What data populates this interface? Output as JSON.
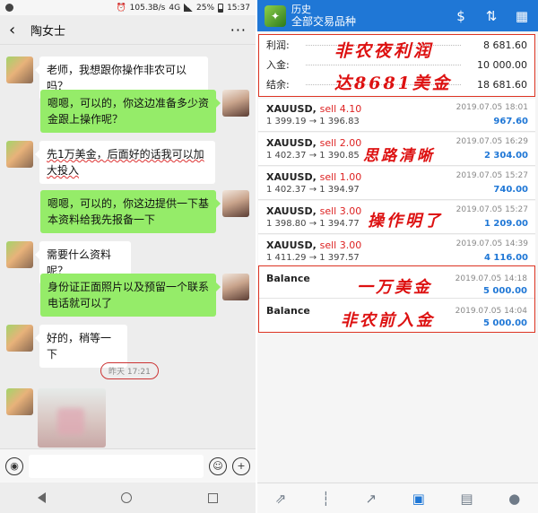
{
  "chat": {
    "status": {
      "speed": "105.3B/s",
      "network": "4G",
      "battery": "25%",
      "time": "15:37"
    },
    "header": {
      "back": "‹",
      "title": "陶女士",
      "more": "···"
    },
    "messages": [
      {
        "side": "in",
        "text": "老师，我想跟你操作非农可以吗？"
      },
      {
        "side": "out",
        "text": "嗯嗯，可以的，你这边准备多少资金跟上操作呢？"
      },
      {
        "side": "in",
        "text": "先1万美金，后面好的话我可以加大投入"
      },
      {
        "side": "out",
        "text": "嗯嗯，可以的，你这边提供一下基本资料给我先报备一下"
      },
      {
        "side": "in",
        "text": "需要什么资料呢？"
      },
      {
        "side": "out",
        "text": "身份证正面照片以及预留一个联系电话就可以了"
      },
      {
        "side": "in",
        "text": "好的，稍等一下"
      }
    ],
    "timestamp": "昨天 17:21"
  },
  "trading": {
    "header": {
      "title": "历史",
      "subtitle": "全部交易品种"
    },
    "summary": [
      {
        "label": "利润:",
        "value": "8 681.60"
      },
      {
        "label": "入金:",
        "value": "10 000.00"
      },
      {
        "label": "结余:",
        "value": "18 681.60"
      }
    ],
    "trades": [
      {
        "symbol": "XAUUSD,",
        "side": "sell 4.10",
        "prices": "1 399.19 → 1 396.83",
        "date": "2019.07.05 18:01",
        "pl": "967.60"
      },
      {
        "symbol": "XAUUSD,",
        "side": "sell 2.00",
        "prices": "1 402.37 → 1 390.85",
        "date": "2019.07.05 16:29",
        "pl": "2 304.00"
      },
      {
        "symbol": "XAUUSD,",
        "side": "sell 1.00",
        "prices": "1 402.37 → 1 394.97",
        "date": "2019.07.05 15:27",
        "pl": "740.00"
      },
      {
        "symbol": "XAUUSD,",
        "side": "sell 3.00",
        "prices": "1 398.80 → 1 394.77",
        "date": "2019.07.05 15:27",
        "pl": "1 209.00"
      },
      {
        "symbol": "XAUUSD,",
        "side": "sell 3.00",
        "prices": "1 411.29 → 1 397.57",
        "date": "2019.07.05 14:39",
        "pl": "4 116.00"
      }
    ],
    "balances": [
      {
        "label": "Balance",
        "date": "2019.07.05 14:18",
        "amount": "5 000.00"
      },
      {
        "label": "Balance",
        "date": "2019.07.05 14:04",
        "amount": "5 000.00"
      }
    ]
  },
  "annotations": {
    "a1": "非农夜利润",
    "a2": "达8681美金",
    "a3": "思路清晰",
    "a4": "操作明了",
    "a5": "一万美金",
    "a6": "非农前入金"
  },
  "colors": {
    "brand_blue": "#1f77d6",
    "wechat_green": "#95ec69",
    "annotation_red": "#d11111",
    "sell_red": "#d22222"
  }
}
